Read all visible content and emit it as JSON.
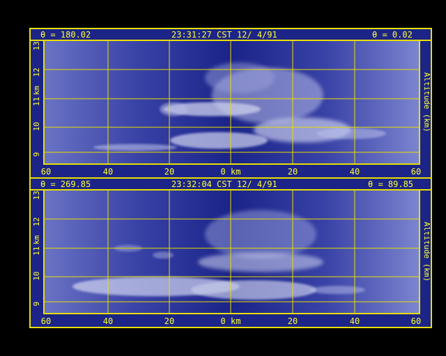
{
  "panels": [
    {
      "id": "top",
      "theta_left": "θ = 180.02",
      "timestamp": "23:31:27 CST 12/ 4/91",
      "theta_right": "θ = 0.02",
      "y_ticks": [
        "9",
        "10",
        "11",
        "12",
        "13"
      ],
      "x_ticks": [
        "60",
        "40",
        "20",
        "0 km",
        "20",
        "40",
        "60"
      ],
      "left_axis_label": "km",
      "right_axis_label": "Altitude (km)"
    },
    {
      "id": "bottom",
      "theta_left": "θ = 269.85",
      "timestamp": "23:32:04 CST 12/ 4/91",
      "theta_right": "θ = 89.85",
      "y_ticks": [
        "9",
        "10",
        "11",
        "12",
        "13"
      ],
      "x_ticks": [
        "60",
        "40",
        "20",
        "0 km",
        "20",
        "40",
        "60"
      ],
      "left_axis_label": "km",
      "right_axis_label": "Altitude (km)"
    }
  ],
  "colors": {
    "background": "#000000",
    "plot_fill": "#1c2487",
    "grid": "#e8e000",
    "text": "#ffff33",
    "cloud": "#d8dcf4"
  }
}
